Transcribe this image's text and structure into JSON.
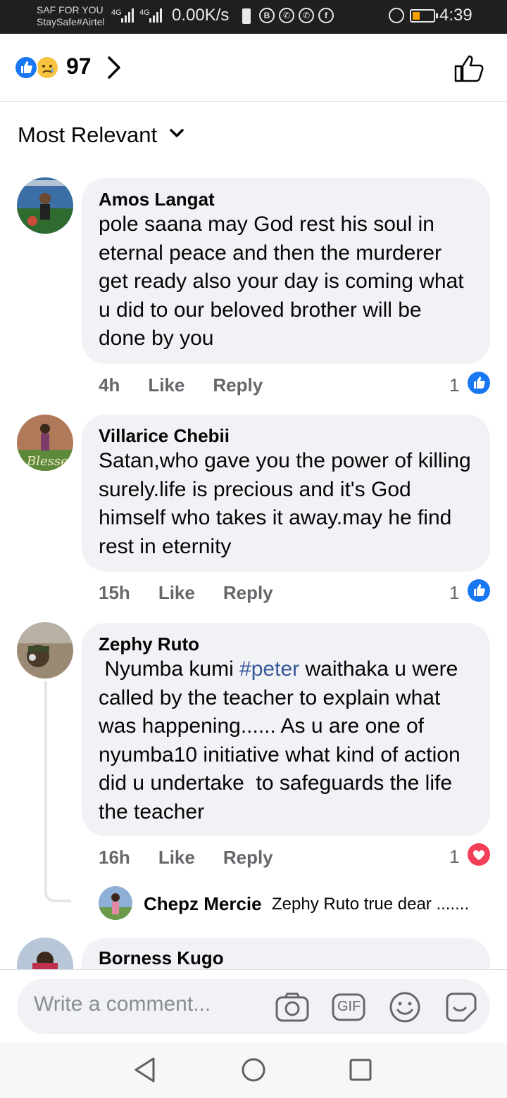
{
  "status_bar": {
    "carrier_line1": "SAF FOR YOU",
    "carrier_line2": "StaySafe#Airtel",
    "net1": "4G",
    "net2": "4G",
    "net_speed": "0.00K/s",
    "time": "4:39",
    "battery_color": "#f4a100"
  },
  "header": {
    "reaction_count": "97",
    "reaction_icons": [
      "like-icon",
      "sad-face-icon"
    ],
    "like_button_icon": "thumbs-up-outline-icon"
  },
  "sort": {
    "label": "Most Relevant"
  },
  "comments": [
    {
      "name": "Amos Langat",
      "text": "pole saana may God rest his soul in eternal peace  and then the murderer get ready also your day is coming what u did to our beloved  brother will be done by you",
      "time": "4h",
      "like": "Like",
      "reply": "Reply",
      "reaction_count": "1",
      "reaction_icon": "like-icon"
    },
    {
      "name": "Villarice Chebii",
      "text": "Satan,who gave you the power of killing surely.life is precious and it's God himself who takes it away.may he find rest in eternity",
      "time": "15h",
      "like": "Like",
      "reply": "Reply",
      "reaction_count": "1",
      "reaction_icon": "like-icon"
    },
    {
      "name": "Zephy Ruto",
      "text_before": " Nyumba kumi ",
      "hashtag": "#peter",
      "text_after": " waithaka u were called by the teacher to explain what was happening...... As u are one of  nyumba10 initiative what kind of action did u undertake  to safeguards the life the teacher",
      "time": "16h",
      "like": "Like",
      "reply": "Reply",
      "reaction_count": "1",
      "reaction_icon": "love-icon",
      "reply_preview": {
        "name": "Chepz Mercie",
        "text": "Zephy Ruto true dear ......."
      }
    },
    {
      "name": "Borness Kugo"
    }
  ],
  "composer": {
    "placeholder": "Write a comment...",
    "icons": [
      "camera-icon",
      "gif-icon",
      "emoji-icon",
      "sticker-icon"
    ],
    "gif_label": "GIF"
  },
  "colors": {
    "like_blue": "#1877f2",
    "love_red": "#f33e58",
    "bubble_gray": "#f0f2f5",
    "meta_gray": "#65676b",
    "hashtag_blue": "#385898"
  }
}
